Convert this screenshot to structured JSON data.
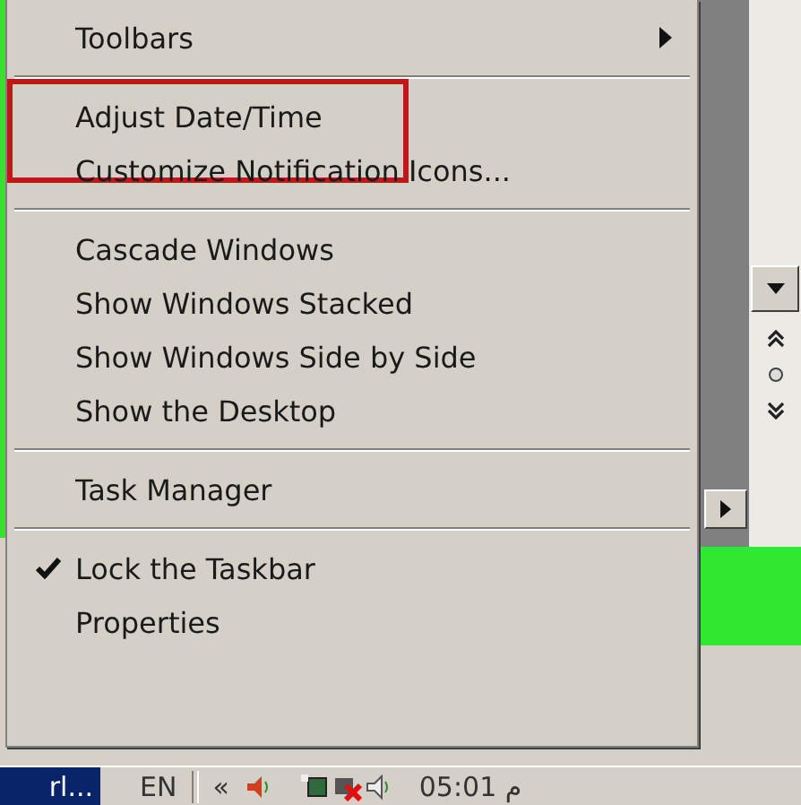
{
  "menu": {
    "items": [
      {
        "kind": "item",
        "label": "Toolbars",
        "checked": false,
        "submenu": true,
        "framed": false
      },
      {
        "kind": "separator"
      },
      {
        "kind": "item",
        "label": "Adjust Date/Time",
        "checked": false,
        "submenu": false,
        "framed": true
      },
      {
        "kind": "item",
        "label": "Customize Notification Icons...",
        "checked": false,
        "submenu": false,
        "framed": false
      },
      {
        "kind": "separator"
      },
      {
        "kind": "item",
        "label": "Cascade Windows",
        "checked": false,
        "submenu": false,
        "framed": false
      },
      {
        "kind": "item",
        "label": "Show Windows Stacked",
        "checked": false,
        "submenu": false,
        "framed": false
      },
      {
        "kind": "item",
        "label": "Show Windows Side by Side",
        "checked": false,
        "submenu": false,
        "framed": false
      },
      {
        "kind": "item",
        "label": "Show the Desktop",
        "checked": false,
        "submenu": false,
        "framed": false
      },
      {
        "kind": "separator"
      },
      {
        "kind": "item",
        "label": "Task Manager",
        "checked": false,
        "submenu": false,
        "framed": false
      },
      {
        "kind": "separator"
      },
      {
        "kind": "item",
        "label": "Lock the Taskbar",
        "checked": true,
        "submenu": false,
        "framed": false
      },
      {
        "kind": "item",
        "label": "Properties",
        "checked": false,
        "submenu": false,
        "framed": false
      }
    ]
  },
  "taskbar": {
    "task_button": "rl...",
    "language": "EN",
    "tray_expand": "«",
    "clock": "05:01 م"
  }
}
